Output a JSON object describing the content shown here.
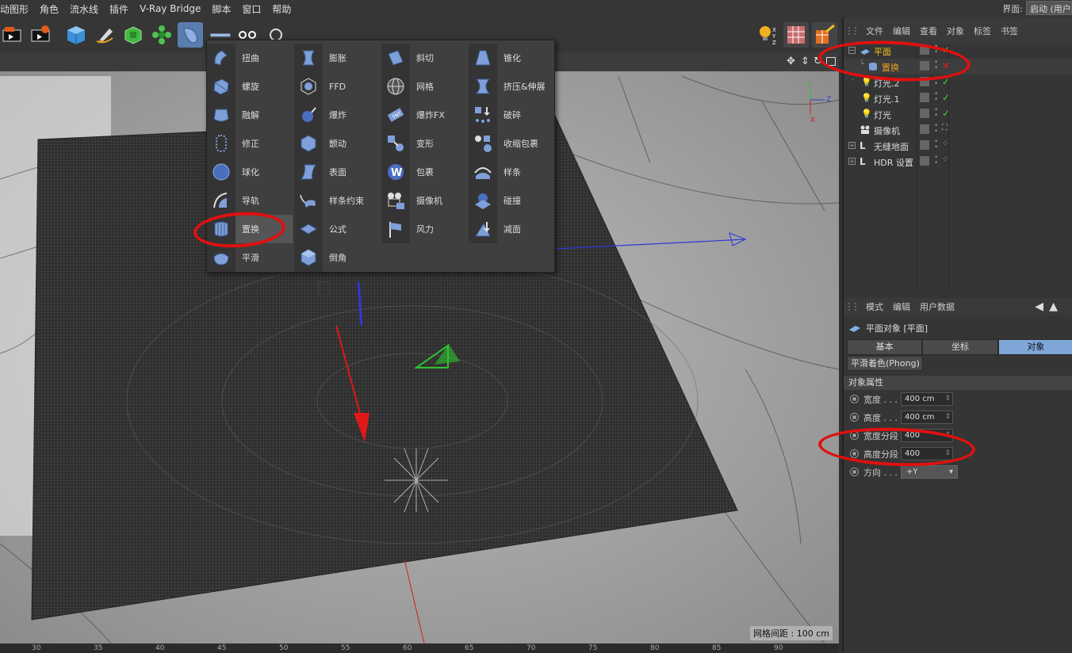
{
  "menu": [
    "动图形",
    "角色",
    "流水线",
    "插件",
    "V-Ray Bridge",
    "脚本",
    "窗口",
    "帮助"
  ],
  "layout": {
    "label": "界面:",
    "value": "启动 (用户"
  },
  "toolbar": {
    "icons": [
      "render-view-icon",
      "render-settings-icon",
      "cube-icon",
      "pen-icon",
      "subdivision-icon",
      "array-icon",
      "deformer-icon",
      "spline-icon",
      "camera-icon",
      "light-icon"
    ]
  },
  "viewport": {
    "grid_spacing": "网格间距 : 100 cm",
    "ruler": [
      "30",
      "35",
      "40",
      "45",
      "50",
      "55",
      "60",
      "65",
      "70",
      "75",
      "80",
      "85",
      "90"
    ]
  },
  "deformers": {
    "col1": [
      "扭曲",
      "螺旋",
      "融解",
      "修正",
      "球化",
      "导轨",
      "置换",
      "平滑"
    ],
    "col2": [
      "膨胀",
      "FFD",
      "爆炸",
      "颤动",
      "表面",
      "样条约束",
      "公式",
      "倒角"
    ],
    "col3": [
      "斜切",
      "网格",
      "爆炸FX",
      "变形",
      "包裹",
      "摄像机",
      "风力"
    ],
    "col4": [
      "锥化",
      "挤压&伸展",
      "破碎",
      "收缩包裹",
      "样条",
      "碰撞",
      "减面"
    ],
    "selected": "置换"
  },
  "objmgr": {
    "tabs": [
      "文件",
      "编辑",
      "查看",
      "对象",
      "标签",
      "书签"
    ],
    "objects": [
      {
        "name": "平面",
        "color": "#f5c020"
      },
      {
        "name": "置换",
        "color": "#e8a020"
      },
      {
        "name": "灯光.2",
        "color": "#ddd"
      },
      {
        "name": "灯光.1",
        "color": "#ddd"
      },
      {
        "name": "灯光",
        "color": "#ddd"
      },
      {
        "name": "摄像机",
        "color": "#ddd"
      },
      {
        "name": "无缝地面",
        "color": "#ddd"
      },
      {
        "name": "HDR 设置",
        "color": "#ddd"
      }
    ]
  },
  "attr": {
    "tabs": [
      "模式",
      "编辑",
      "用户数据"
    ],
    "title": "平面对象 [平面]",
    "mtabs": [
      "基本",
      "坐标",
      "对象"
    ],
    "phong": "平滑着色(Phong)",
    "section": "对象属性",
    "props": [
      {
        "label": "宽度 . . .",
        "value": "400 cm"
      },
      {
        "label": "高度 . . .",
        "value": "400 cm"
      },
      {
        "label": "宽度分段",
        "value": "400"
      },
      {
        "label": "高度分段",
        "value": "400"
      },
      {
        "label": "方向 . . .",
        "value": "+Y"
      }
    ]
  },
  "colors": {
    "accent": "#7fa6d8",
    "annotation": "#e01010"
  }
}
